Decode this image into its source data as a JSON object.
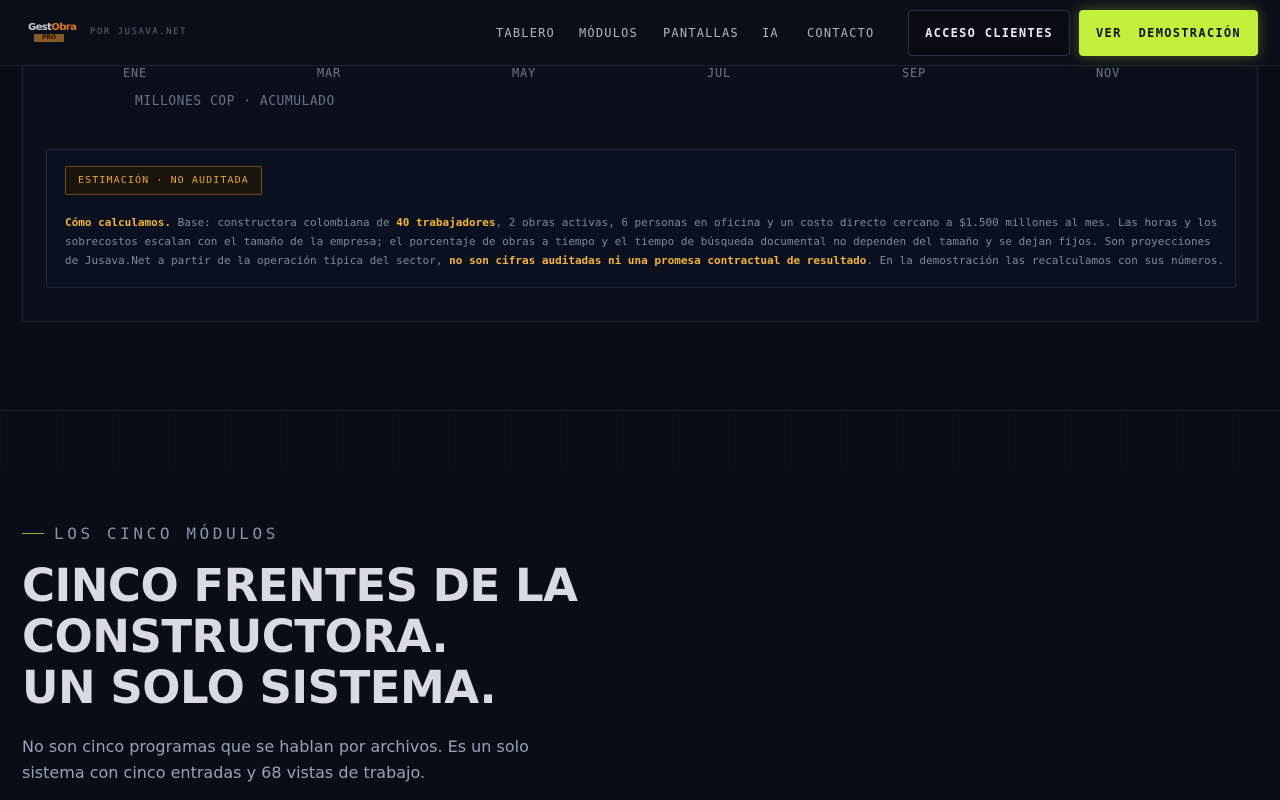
{
  "nav": {
    "logo_word_a": "Gest",
    "logo_word_b": "Obra",
    "logo_badge": "PRO",
    "byline": "POR JUSAVA.NET",
    "links": [
      {
        "label": "TABLERO"
      },
      {
        "label": "MÓDULOS"
      },
      {
        "label": "PANTALLAS"
      },
      {
        "label": "IA"
      },
      {
        "label": "CONTACTO"
      }
    ],
    "clients_button": "ACCESO CLIENTES",
    "demo_button": "VER  DEMOSTRACIÓN"
  },
  "chart": {
    "months": [
      "ENE",
      "MAR",
      "MAY",
      "JUL",
      "SEP",
      "NOV"
    ],
    "unit_label": "MILLONES COP · ACUMULADO"
  },
  "note": {
    "badge": "ESTIMACIÓN · NO AUDITADA",
    "lead": "Cómo calculamos.",
    "t1": " Base: constructora colombiana de ",
    "hl1": "40 trabajadores",
    "t2": ", 2 obras activas, 6 personas en oficina y un costo directo cercano a $1.500 millones al mes. Las horas y los sobrecostos escalan con el tamaño de la empresa; el porcentaje de obras a tiempo y el tiempo de búsqueda documental no dependen del tamaño y se dejan fijos. Son proyecciones de Jusava.Net a partir de la operación típica del sector, ",
    "hl2": "no son cifras auditadas ni una promesa contractual de resultado",
    "t3": ". En la demostración las recalculamos con sus números."
  },
  "modules": {
    "eyebrow": "LOS CINCO MÓDULOS",
    "headline": [
      "CINCO FRENTES DE LA",
      "CONSTRUCTORA.",
      "UN SOLO SISTEMA."
    ],
    "lead": "No son cinco programas que se hablan por archivos. Es un solo sistema con cinco entradas y 68 vistas de trabajo."
  },
  "colors": {
    "accent": "#c2f03b",
    "warning": "#f0b530",
    "background": "#090d18"
  }
}
